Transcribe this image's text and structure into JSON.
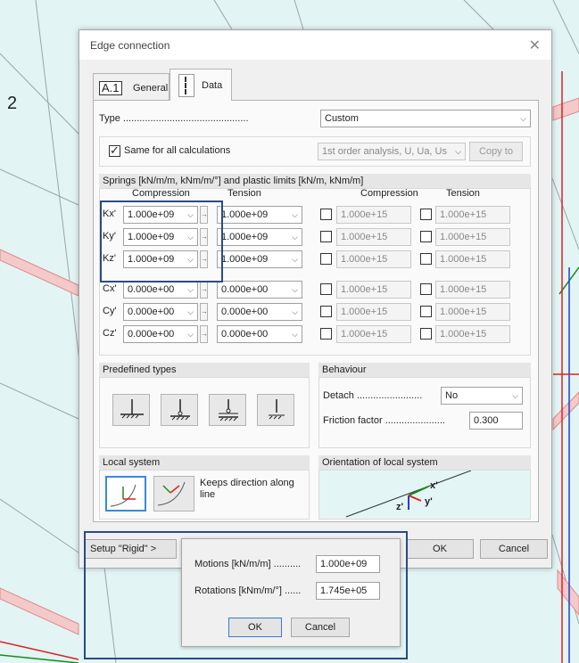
{
  "dialog": {
    "title": "Edge connection"
  },
  "tabs": [
    {
      "icon": "A.1",
      "label": "General"
    },
    {
      "label": "Data"
    }
  ],
  "type": {
    "label": "Type",
    "value": "Custom"
  },
  "same_for_all": {
    "label": "Same for all calculations",
    "checked": true,
    "analysis_value": "1st order analysis, U, Ua, Us",
    "copy_to": "Copy to"
  },
  "springs": {
    "header": "Springs [kN/m/m, kNm/m/°] and plastic limits [kN/m, kNm/m]",
    "col_compression": "Compression",
    "col_tension": "Tension",
    "col_compression_limit": "Compression",
    "col_tension_limit": "Tension",
    "rows": [
      {
        "label": "Kx'",
        "compression": "1.000e+09",
        "tension": "1.000e+09",
        "comp_limit": "1.000e+15",
        "tens_limit": "1.000e+15"
      },
      {
        "label": "Ky'",
        "compression": "1.000e+09",
        "tension": "1.000e+09",
        "comp_limit": "1.000e+15",
        "tens_limit": "1.000e+15"
      },
      {
        "label": "Kz'",
        "compression": "1.000e+09",
        "tension": "1.000e+09",
        "comp_limit": "1.000e+15",
        "tens_limit": "1.000e+15"
      },
      {
        "label": "Cx'",
        "compression": "0.000e+00",
        "tension": "0.000e+00",
        "comp_limit": "1.000e+15",
        "tens_limit": "1.000e+15"
      },
      {
        "label": "Cy'",
        "compression": "0.000e+00",
        "tension": "0.000e+00",
        "comp_limit": "1.000e+15",
        "tens_limit": "1.000e+15"
      },
      {
        "label": "Cz'",
        "compression": "0.000e+00",
        "tension": "0.000e+00",
        "comp_limit": "1.000e+15",
        "tens_limit": "1.000e+15"
      }
    ]
  },
  "predefined": {
    "header": "Predefined types"
  },
  "behaviour": {
    "header": "Behaviour",
    "detach_label": "Detach",
    "detach_value": "No",
    "friction_label": "Friction factor",
    "friction_value": "0.300"
  },
  "local_system": {
    "header": "Local system",
    "keeps_direction": "Keeps direction along line"
  },
  "orientation": {
    "header": "Orientation of local system",
    "axis_x": "x'",
    "axis_y": "y'",
    "axis_z": "z'"
  },
  "footer": {
    "setup_rigid": "Setup \"Rigid\" >",
    "ok": "OK",
    "cancel": "Cancel"
  },
  "rigid_popup": {
    "motions_label": "Motions [kN/m/m]",
    "motions_value": "1.000e+09",
    "rotations_label": "Rotations [kNm/m/°]",
    "rotations_value": "1.745e+05",
    "ok": "OK",
    "cancel": "Cancel"
  },
  "background_text": "2",
  "colors": {
    "highlight": "#2a4a8a",
    "canvas": "#e2f4f4",
    "axis_green": "#1a8a1a",
    "axis_blue": "#2040d0",
    "axis_red": "#e02020"
  }
}
